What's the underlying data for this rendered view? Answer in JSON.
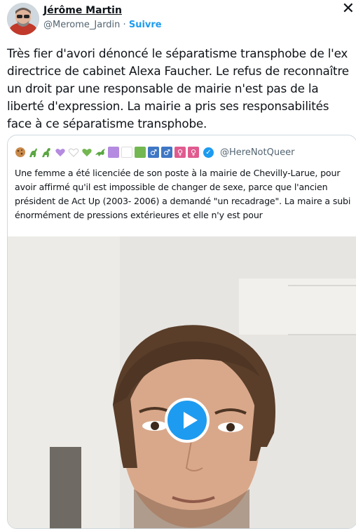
{
  "header": {
    "name": "Jérôme Martin",
    "handle": "@Merome_Jardin",
    "separator": " · ",
    "follow_label": "Suivre",
    "close_glyph": "✕"
  },
  "tweet": {
    "text": "Très fier d'avori dénoncé le séparatisme transphobe de l'ex directrice de cabinet Alexa Faucher.  Le refus de reconnaître un droit par une responsable de mairie n'est pas de la liberté d'expression. La mairie a pris ses responsabilités face à ce séparatisme transphobe."
  },
  "quote": {
    "handle": "@HereNotQueer",
    "verified_glyph": "✓",
    "text": "Une femme a été licenciée de son poste à la mairie de Chevilly-Larue, pour avoir affirmé qu'il est impossible de changer de sexe, parce que l'ancien président de Act Up (2003- 2006) a demandé \"un recadrage\". La maire a subi énormément de pressions extérieures et elle n'y est pour",
    "emoji_row": [
      "cookie-icon",
      "dinosaur-icon",
      "dinosaur-icon",
      "purple-heart-icon",
      "white-heart-icon",
      "green-heart-icon",
      "dragon-icon",
      "purple-square-icon",
      "white-square-icon",
      "green-square-icon",
      "male-sign-icon",
      "male-sign-icon",
      "female-sign-icon",
      "female-sign-icon"
    ],
    "symbols": {
      "male": "♂",
      "female": "♀"
    }
  },
  "colors": {
    "accent": "#1d9bf0",
    "text": "#0f1419",
    "muted": "#536471",
    "border": "#cfd9de",
    "purple": "#b48be0",
    "green": "#73b751",
    "blue_sign": "#3e77c4",
    "pink_sign": "#e05b8f"
  }
}
